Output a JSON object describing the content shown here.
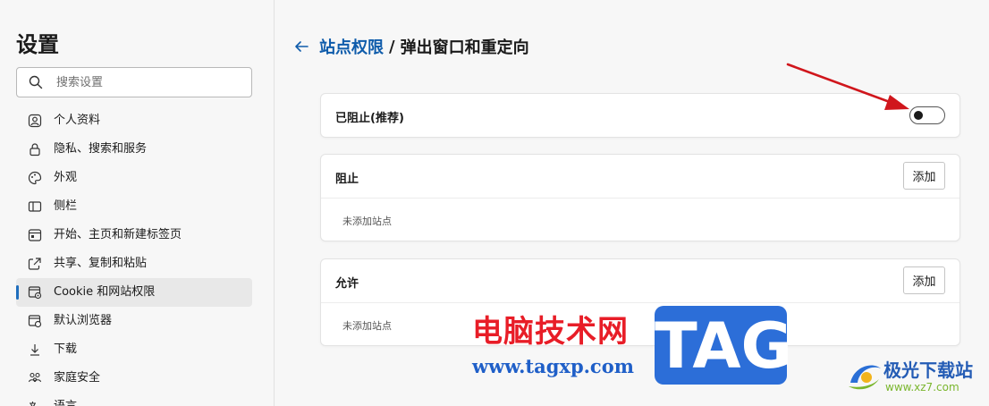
{
  "sidebar": {
    "title": "设置",
    "search_placeholder": "搜索设置",
    "items": [
      {
        "label": "个人资料",
        "icon": "profile-icon"
      },
      {
        "label": "隐私、搜索和服务",
        "icon": "lock-icon"
      },
      {
        "label": "外观",
        "icon": "palette-icon"
      },
      {
        "label": "侧栏",
        "icon": "sidebar-icon"
      },
      {
        "label": "开始、主页和新建标签页",
        "icon": "home-tab-icon"
      },
      {
        "label": "共享、复制和粘贴",
        "icon": "share-icon"
      },
      {
        "label": "Cookie 和网站权限",
        "icon": "site-permissions-icon",
        "active": true
      },
      {
        "label": "默认浏览器",
        "icon": "browser-icon"
      },
      {
        "label": "下载",
        "icon": "download-icon"
      },
      {
        "label": "家庭安全",
        "icon": "family-icon"
      },
      {
        "label": "语言",
        "icon": "language-icon"
      }
    ]
  },
  "header": {
    "breadcrumb_link": "站点权限",
    "separator": "/",
    "current": "弹出窗口和重定向"
  },
  "blocked_setting": {
    "label": "已阻止(推荐)",
    "toggle_on": false
  },
  "block_section": {
    "title": "阻止",
    "add_label": "添加",
    "empty": "未添加站点"
  },
  "allow_section": {
    "title": "允许",
    "add_label": "添加",
    "empty": "未添加站点"
  },
  "watermark": {
    "cn_text": "电脑技术网",
    "url": "www.tagxp.com",
    "tag": "TAG",
    "site_name": "极光下载站",
    "site_url": "www.xz7.com"
  },
  "colors": {
    "accent": "#0f5cab",
    "arrow": "#d0161c",
    "watermark_red": "#e81d27",
    "watermark_blue": "#2c6ed8"
  }
}
